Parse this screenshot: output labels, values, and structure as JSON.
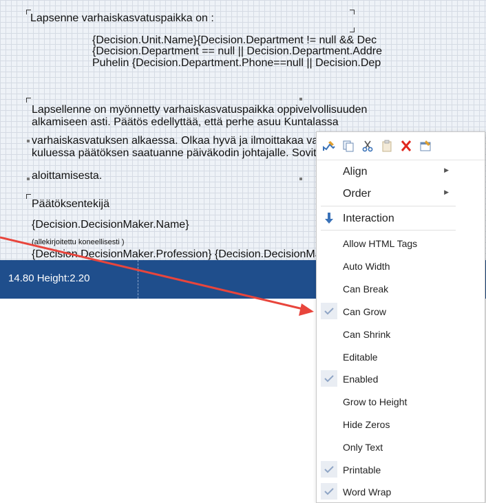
{
  "report": {
    "line1": "Lapsenne varhaiskasvatuspaikka on :",
    "line2": "{Decision.Unit.Name}{Decision.Department != null && Dec",
    "line3": "{Decision.Department == null || Decision.Department.Addre",
    "line4": "Puhelin {Decision.Department.Phone==null || Decision.Dep",
    "para1": "Lapsellenne on myönnetty varhaiskasvatuspaikka oppivelvollisuuden",
    "para2": "alkamiseen asti. Päätös edellyttää, että perhe asuu Kuntalassa",
    "para3": "varhaiskasvatuksen alkaessa. Olkaa hyvä ja ilmoittakaa vastaanotatteko",
    "para4": "kuluessa päätöksen saatuanne päiväkodin johtajalle. Sovittakaa hoidon",
    "para5": "aloittamisesta.",
    "signer_heading": "Päätöksentekijä",
    "signer_name": "{Decision.DecisionMaker.Name}",
    "signed_note": "(allekirjoitettu koneellisesti  )",
    "signer_profession": "{Decision.DecisionMaker.Profession} {Decision.DecisionMaker.Phone"
  },
  "statusbar": {
    "dimensions": "14.80 Height:2.20"
  },
  "toolbar": {
    "icons": [
      "edit-icon",
      "copy-icon",
      "cut-icon",
      "paste-icon",
      "delete-icon",
      "properties-icon"
    ]
  },
  "menu": {
    "align": "Align",
    "order": "Order",
    "interaction": "Interaction",
    "allow_html_tags": "Allow HTML Tags",
    "auto_width": "Auto Width",
    "can_break": "Can Break",
    "can_grow": "Can Grow",
    "can_shrink": "Can Shrink",
    "editable": "Editable",
    "enabled": "Enabled",
    "grow_to_height": "Grow to Height",
    "hide_zeros": "Hide Zeros",
    "only_text": "Only Text",
    "printable": "Printable",
    "word_wrap": "Word Wrap"
  },
  "menu_checked": {
    "can_grow": true,
    "enabled": true,
    "printable": true,
    "word_wrap": true
  },
  "colors": {
    "statusbar": "#1f4e8c",
    "arrow": "#e8453c",
    "check": "#8fa5c6"
  }
}
